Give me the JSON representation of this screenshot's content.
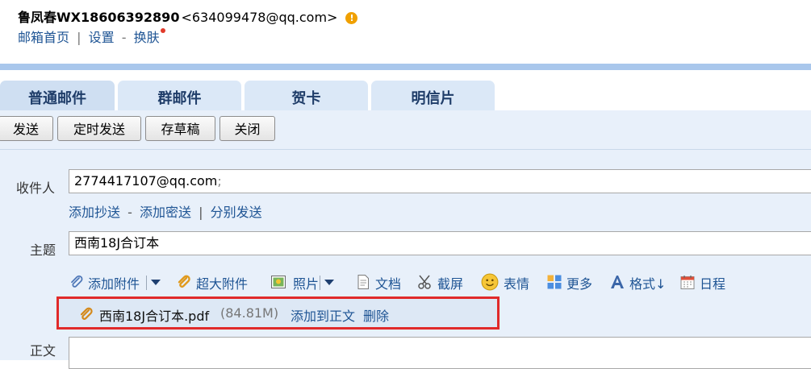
{
  "header": {
    "user_name": "鲁凤春WX18606392890",
    "user_email": "<634099478@qq.com>",
    "warning_glyph": "!",
    "links": {
      "home": "邮箱首页",
      "sep": "|",
      "settings": "设置",
      "dash": "-",
      "skin": "换肤"
    }
  },
  "tabs": [
    {
      "label": "普通邮件",
      "active": true
    },
    {
      "label": "群邮件"
    },
    {
      "label": "贺卡"
    },
    {
      "label": "明信片"
    }
  ],
  "toolbar": {
    "send": "发送",
    "timed_send": "定时发送",
    "save_draft": "存草稿",
    "close": "关闭"
  },
  "form": {
    "to_label": "收件人",
    "to_value": "2774417107@qq.com",
    "to_semicolon": ";",
    "cc_links": {
      "add_cc": "添加抄送",
      "dash": "-",
      "add_bcc": "添加密送",
      "sep": "|",
      "separate_send": "分别发送"
    },
    "subject_label": "主题",
    "subject_value": "西南18J合订本",
    "body_label": "正文"
  },
  "attach_toolbar": {
    "add_attachment": "添加附件",
    "super_attachment": "超大附件",
    "photo": "照片",
    "document": "文档",
    "screenshot": "截屏",
    "emoji": "表情",
    "more": "更多",
    "format": "格式↓",
    "schedule": "日程"
  },
  "attachment": {
    "name": "西南18J合订本.pdf",
    "size": "(84.81M)",
    "add_to_body": "添加到正文",
    "delete": "删除"
  },
  "colors": {
    "accent_blue_bar": "#a9c7ec",
    "tab_bg": "#dbe8f7",
    "compose_bg": "#e8f0fa",
    "link": "#1e5494",
    "highlight_border": "#e02a2a",
    "warning": "#f0a000"
  }
}
